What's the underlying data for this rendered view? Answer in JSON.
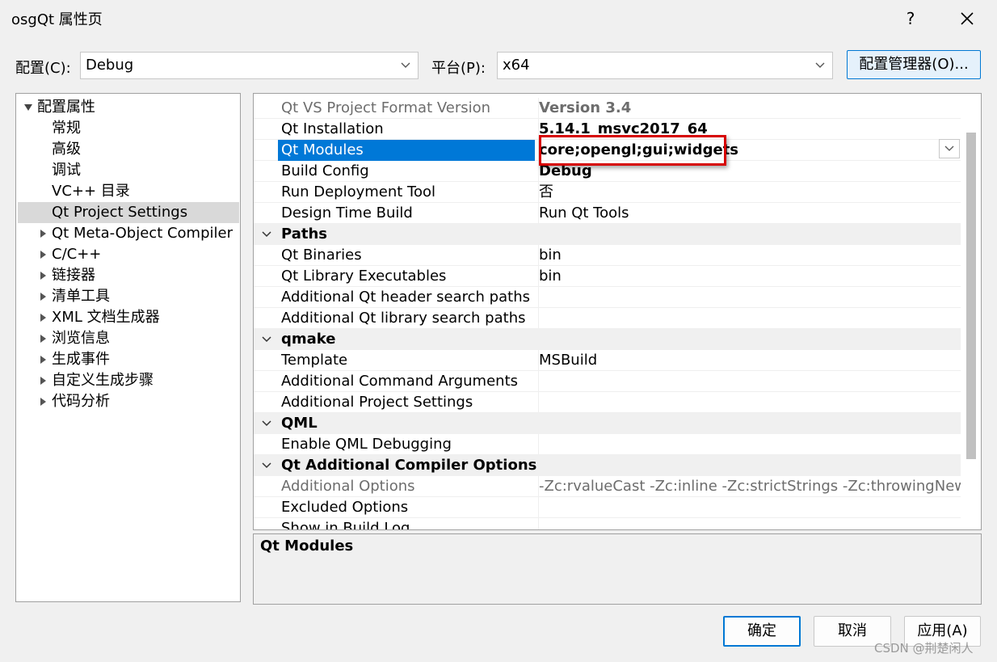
{
  "window": {
    "title": "osgQt 属性页",
    "help_label": "?"
  },
  "config": {
    "config_label": "配置(C):",
    "config_value": "Debug",
    "platform_label": "平台(P):",
    "platform_value": "x64",
    "manager_label": "配置管理器(O)..."
  },
  "tree": {
    "root": "配置属性",
    "children": [
      "常规",
      "高级",
      "调试",
      "VC++ 目录",
      "Qt Project Settings"
    ],
    "expandable": [
      "Qt Meta-Object Compiler",
      "C/C++",
      "链接器",
      "清单工具",
      "XML 文档生成器",
      "浏览信息",
      "生成事件",
      "自定义生成步骤",
      "代码分析"
    ],
    "selected": "Qt Project Settings"
  },
  "grid": {
    "rows": [
      {
        "name": "Qt VS Project Format Version",
        "value": "Version 3.4"
      },
      {
        "name": "Qt Installation",
        "value": "5.14.1_msvc2017_64"
      },
      {
        "name": "Qt Modules",
        "value": "core;opengl;gui;widgets"
      },
      {
        "name": "Build Config",
        "value": "Debug"
      },
      {
        "name": "Run Deployment Tool",
        "value": "否"
      },
      {
        "name": "Design Time Build",
        "value": "Run Qt Tools"
      },
      {
        "category": "Paths"
      },
      {
        "name": "Qt Binaries",
        "value": "bin"
      },
      {
        "name": "Qt Library Executables",
        "value": "bin"
      },
      {
        "name": "Additional Qt header search paths",
        "value": ""
      },
      {
        "name": "Additional Qt library search paths",
        "value": ""
      },
      {
        "category": "qmake"
      },
      {
        "name": "Template",
        "value": "MSBuild"
      },
      {
        "name": "Additional Command Arguments",
        "value": ""
      },
      {
        "name": "Additional Project Settings",
        "value": ""
      },
      {
        "category": "QML"
      },
      {
        "name": "Enable QML Debugging",
        "value": ""
      },
      {
        "category": "Qt Additional Compiler Options"
      },
      {
        "name": "Additional Options",
        "value": "-Zc:rvalueCast -Zc:inline -Zc:strictStrings -Zc:throwingNew -Z"
      },
      {
        "name": "Excluded Options",
        "value": ""
      },
      {
        "name": "Show in Build Log",
        "value": ""
      }
    ],
    "selected": "Qt Modules"
  },
  "description": {
    "title": "Qt Modules"
  },
  "buttons": {
    "ok": "确定",
    "cancel": "取消",
    "apply": "应用(A)"
  },
  "watermark": "CSDN @荆楚闲人",
  "colors": {
    "selection": "#0078d7",
    "highlight_box": "#d60000",
    "accent": "#0078d4"
  }
}
